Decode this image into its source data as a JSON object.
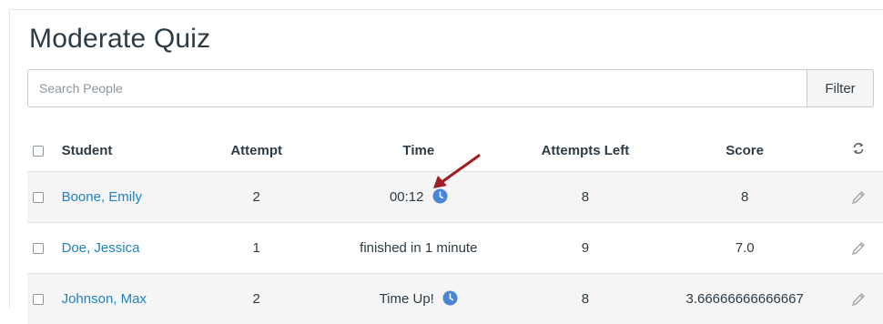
{
  "page": {
    "title": "Moderate Quiz"
  },
  "search": {
    "placeholder": "Search People",
    "value": "",
    "filter_label": "Filter"
  },
  "table": {
    "headers": {
      "student": "Student",
      "attempt": "Attempt",
      "time": "Time",
      "attempts_left": "Attempts Left",
      "score": "Score"
    },
    "rows": [
      {
        "student": "Boone, Emily",
        "attempt": "2",
        "time": "00:12",
        "time_icon": "clock-icon",
        "attempts_left": "8",
        "score": "8"
      },
      {
        "student": "Doe, Jessica",
        "attempt": "1",
        "time": "finished in 1 minute",
        "time_icon": "",
        "attempts_left": "9",
        "score": "7.0"
      },
      {
        "student": "Johnson, Max",
        "attempt": "2",
        "time": "Time Up!",
        "time_icon": "clock-icon",
        "attempts_left": "8",
        "score": "3.66666666666667"
      }
    ]
  },
  "icons": {
    "header_action": "refresh-icon",
    "row_action": "pencil-icon",
    "annotation": "arrow-icon"
  },
  "colors": {
    "link": "#1d82c6",
    "clock": "#4a85d6",
    "annotation_arrow": "#a11d21",
    "row_shade": "#f5f5f5",
    "text": "#2d3b45"
  }
}
